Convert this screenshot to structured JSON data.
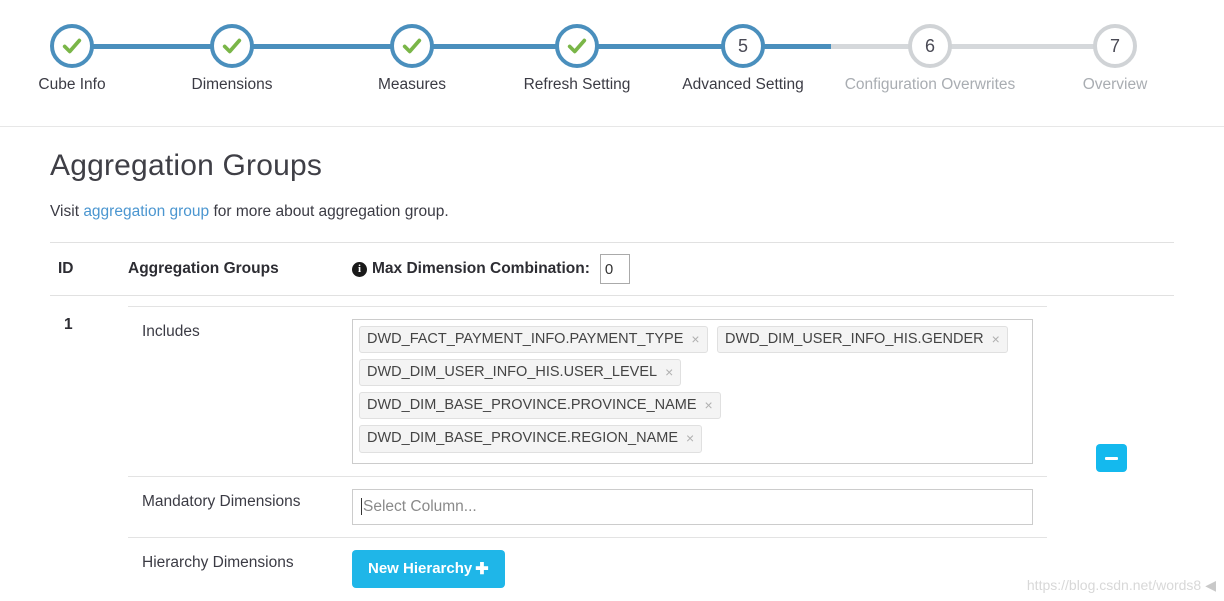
{
  "stepper": {
    "steps": [
      {
        "index": "1",
        "label": "Cube Info",
        "state": "completed",
        "icon": "check-icon"
      },
      {
        "index": "2",
        "label": "Dimensions",
        "state": "completed",
        "icon": "check-icon"
      },
      {
        "index": "3",
        "label": "Measures",
        "state": "completed",
        "icon": "check-icon"
      },
      {
        "index": "4",
        "label": "Refresh Setting",
        "state": "completed",
        "icon": "check-icon"
      },
      {
        "index": "5",
        "label": "Advanced Setting",
        "state": "active",
        "icon": ""
      },
      {
        "index": "6",
        "label": "Configuration Overwrites",
        "state": "inactive",
        "icon": ""
      },
      {
        "index": "7",
        "label": "Overview",
        "state": "inactive",
        "icon": ""
      }
    ],
    "colors": {
      "active": "#4a8fbd",
      "inactive": "#d0d3d6",
      "check": "#7ab648"
    }
  },
  "page": {
    "title": "Aggregation Groups",
    "visit_prefix": "Visit ",
    "visit_link": "aggregation group",
    "visit_suffix": " for more about aggregation group."
  },
  "table": {
    "header": {
      "id_label": "ID",
      "groups_label": "Aggregation Groups",
      "info_icon_glyph": "i",
      "max_dim_label": "Max Dimension Combination:",
      "max_dim_value": "0"
    },
    "rows": [
      {
        "id": "1",
        "remove_button_icon": "minus-icon",
        "fields": [
          {
            "label": "Includes",
            "type": "chips",
            "chips": [
              "DWD_FACT_PAYMENT_INFO.PAYMENT_TYPE",
              "DWD_DIM_USER_INFO_HIS.GENDER",
              "DWD_DIM_USER_INFO_HIS.USER_LEVEL",
              "DWD_DIM_BASE_PROVINCE.PROVINCE_NAME",
              "DWD_DIM_BASE_PROVINCE.REGION_NAME"
            ],
            "chip_close_glyph": "×"
          },
          {
            "label": "Mandatory Dimensions",
            "type": "select",
            "value": "",
            "placeholder": "Select Column..."
          },
          {
            "label": "Hierarchy Dimensions",
            "type": "button",
            "button_label": "New Hierarchy",
            "button_plus_glyph": "✚",
            "button_color": "#1fb6e8"
          }
        ]
      }
    ]
  },
  "watermark": {
    "text": "https://blog.csdn.net/words8",
    "mark": "◀"
  }
}
